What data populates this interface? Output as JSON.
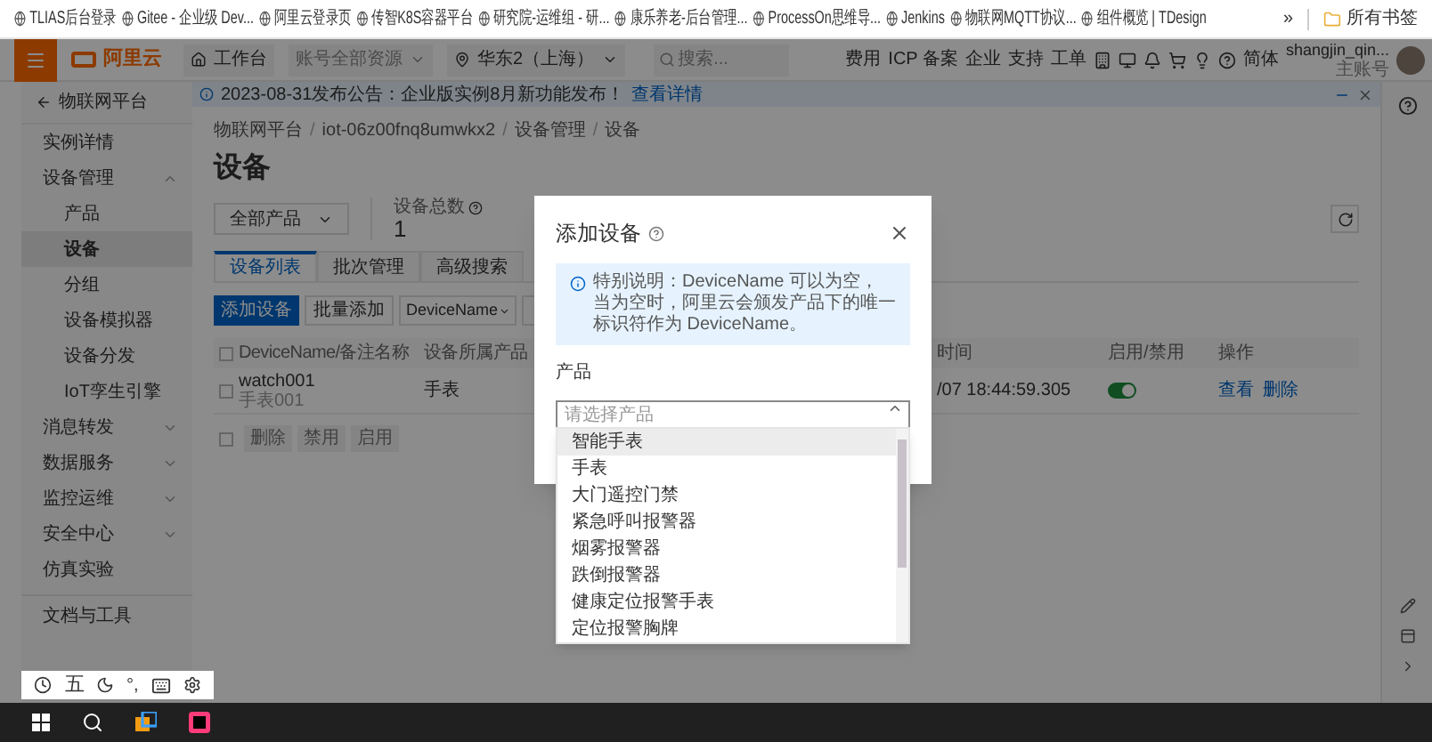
{
  "bookmarks": [
    {
      "label": "TLIAS后台登录"
    },
    {
      "label": "Gitee - 企业级 Dev..."
    },
    {
      "label": "阿里云登录页"
    },
    {
      "label": "传智K8S容器平台"
    },
    {
      "label": "研究院-运维组 - 研..."
    },
    {
      "label": "康乐养老-后台管理..."
    },
    {
      "label": "ProcessOn思维导..."
    },
    {
      "label": "Jenkins"
    },
    {
      "label": "物联网MQTT协议..."
    },
    {
      "label": "组件概览 | TDesign"
    }
  ],
  "bookmarks_more": "»",
  "all_bookmarks": "所有书签",
  "topbar": {
    "logo": "阿里云",
    "workbench": "工作台",
    "resources": "账号全部资源",
    "region": "华东2（上海）",
    "search_placeholder": "搜索...",
    "links": [
      "费用",
      "ICP 备案",
      "企业",
      "支持",
      "工单"
    ],
    "language": "简体",
    "user": "shangjin_qin...",
    "role": "主账号"
  },
  "sidebar": {
    "back": "物联网平台",
    "items": [
      {
        "kind": "link",
        "label": "实例详情",
        "selected": false
      },
      {
        "kind": "group",
        "label": "设备管理",
        "expanded": true,
        "children": [
          {
            "label": "产品",
            "selected": false
          },
          {
            "label": "设备",
            "selected": true
          },
          {
            "label": "分组",
            "selected": false
          },
          {
            "label": "设备模拟器",
            "selected": false
          },
          {
            "label": "设备分发",
            "selected": false
          },
          {
            "label": "IoT孪生引擎",
            "selected": false
          }
        ]
      },
      {
        "kind": "group",
        "label": "消息转发",
        "expanded": false
      },
      {
        "kind": "group",
        "label": "数据服务",
        "expanded": false
      },
      {
        "kind": "group",
        "label": "监控运维",
        "expanded": false
      },
      {
        "kind": "group",
        "label": "安全中心",
        "expanded": false
      },
      {
        "kind": "link",
        "label": "仿真实验",
        "selected": false
      },
      {
        "kind": "footer",
        "label": "文档与工具",
        "selected": false
      }
    ]
  },
  "notice": {
    "text": "2023-08-31发布公告：企业版实例8月新功能发布！",
    "link": "查看详情"
  },
  "breadcrumb": [
    {
      "label": "物联网平台",
      "separator": "/"
    },
    {
      "label": "iot-06z00fnq8umwkx2",
      "separator": "/"
    },
    {
      "label": "设备管理",
      "separator": "/"
    },
    {
      "label": "设备"
    }
  ],
  "title": "设备",
  "product_filter": "全部产品",
  "stat": {
    "label": "设备总数",
    "value": "1"
  },
  "tabs": [
    {
      "label": "设备列表",
      "selected": true
    },
    {
      "label": "批次管理",
      "selected": false
    },
    {
      "label": "高级搜索",
      "selected": false
    }
  ],
  "toolbar": {
    "add": "添加设备",
    "batch_add": "批量添加",
    "field": "DeviceName"
  },
  "table": {
    "header_checked": false,
    "columns": [
      "DeviceName/备注名称",
      "设备所属产品",
      "时间",
      "启用/禁用",
      "操作"
    ],
    "rows": [
      {
        "checked": false,
        "name": "watch001",
        "note": "手表001",
        "product": "手表",
        "time": "/07 18:44:59.305",
        "enabled": true,
        "actions": [
          "查看",
          "删除"
        ]
      }
    ],
    "footer_checked": false
  },
  "bulk_buttons": [
    {
      "label": "删除",
      "disabled": true
    },
    {
      "label": "禁用",
      "disabled": true
    },
    {
      "label": "启用",
      "disabled": true
    }
  ],
  "dialog": {
    "title": "添加设备",
    "alert": "特别说明：DeviceName 可以为空，当为空时，阿里云会颁发产品下的唯一标识符作为 DeviceName。",
    "field_label": "产品",
    "placeholder": "请选择产品",
    "options": [
      {
        "label": "智能手表",
        "highlighted": true
      },
      {
        "label": "手表",
        "highlighted": false
      },
      {
        "label": "大门遥控门禁",
        "highlighted": false
      },
      {
        "label": "紧急呼叫报警器",
        "highlighted": false
      },
      {
        "label": "烟雾报警器",
        "highlighted": false
      },
      {
        "label": "跌倒报警器",
        "highlighted": false
      },
      {
        "label": "健康定位报警手表",
        "highlighted": false
      },
      {
        "label": "定位报警胸牌",
        "highlighted": false
      }
    ]
  },
  "ime": {
    "mode": "五",
    "punctuation": "°,"
  }
}
